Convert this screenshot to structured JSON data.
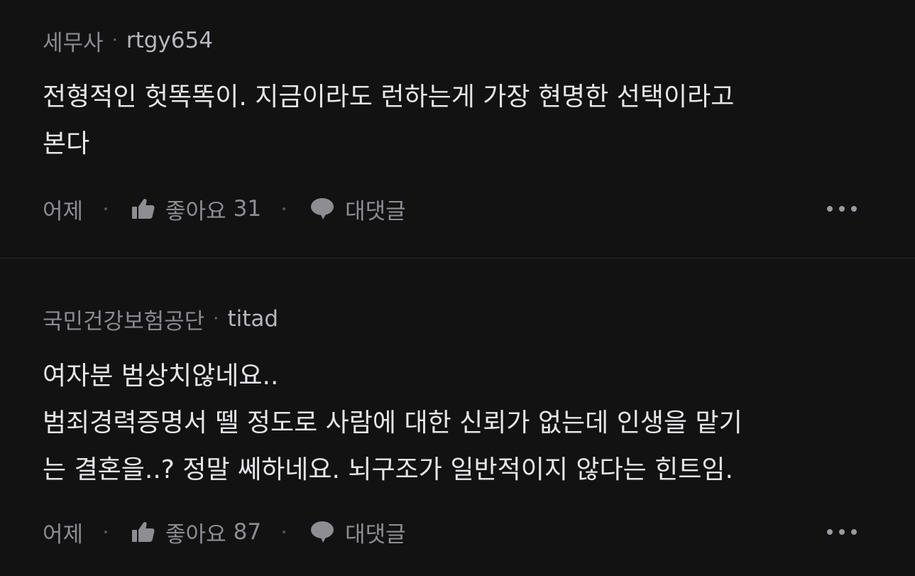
{
  "comments": [
    {
      "company": "세무사",
      "nickname": "rtgy654",
      "text": "전형적인 헛똑똑이. 지금이라도 런하는게 가장 현명한 선택이라고\n본다",
      "time": "어제",
      "like_label": "좋아요",
      "like_count": "31",
      "reply_label": "대댓글"
    },
    {
      "company": "국민건강보험공단",
      "nickname": "titad",
      "text": "여자분 범상치않네요..\n범죄경력증명서 뗄 정도로 사람에 대한 신뢰가 없는데 인생을 맡기\n는 결혼을..? 정말 쎄하네요. 뇌구조가 일반적이지 않다는 힌트임.",
      "time": "어제",
      "like_label": "좋아요",
      "like_count": "87",
      "reply_label": "대댓글"
    }
  ],
  "meta_separator": "·",
  "icons": {
    "like": "thumbs-up-icon",
    "reply": "speech-bubble-icon",
    "more": "more-dots-icon"
  },
  "colors": {
    "background": "#121213",
    "text": "#e6e6e8",
    "muted": "#8d8d92"
  }
}
